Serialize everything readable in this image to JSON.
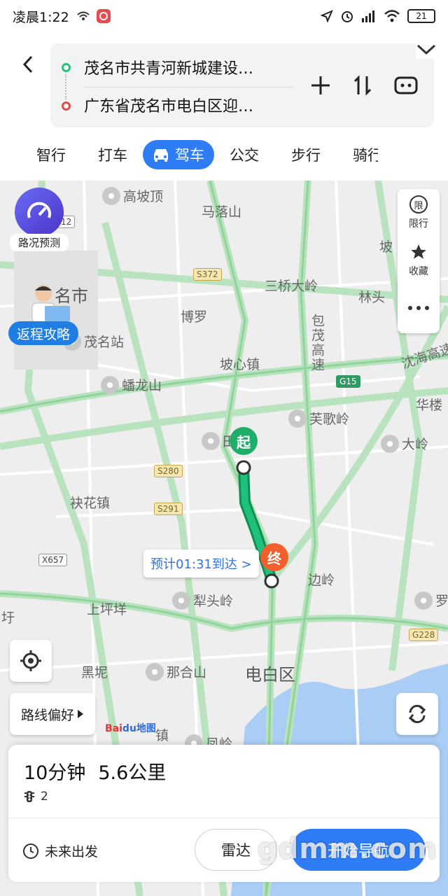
{
  "status_bar": {
    "time": "凌晨1:22",
    "battery": "21"
  },
  "route": {
    "origin": "茂名市共青河新城建设…",
    "destination": "广东省茂名市电白区迎…"
  },
  "modes": [
    {
      "label": "智行"
    },
    {
      "label": "打车"
    },
    {
      "label": "驾车",
      "active": true
    },
    {
      "label": "公交"
    },
    {
      "label": "步行"
    },
    {
      "label": "骑行"
    }
  ],
  "map": {
    "forecast_label": "路况预测",
    "return_guide_label": "返程攻略",
    "side_panel": {
      "restrict_label": "限行",
      "restrict_badge": "限",
      "favorite_label": "收藏"
    },
    "places": {
      "gaopoding": "高坡顶",
      "maluoshan": "马落山",
      "maoming_city": "名市",
      "boluo": "博罗",
      "sanqiao": "三桥大岭",
      "pocheng": "坡",
      "lintou": "林头",
      "maoming_station": "茂名站",
      "poxin": "坡心镇",
      "shanlongshan": "蟠龙山",
      "yinggeling": "芙歌岭",
      "tianshan": "田山",
      "daling": "大岭",
      "hualou": "华楼",
      "fuhua": "袂花镇",
      "bianling": "边岭",
      "litouling": "犁头岭",
      "shangpingyang": "上坪垟",
      "heini": "黑坭",
      "nahe": "那合山",
      "dianbai": "电白区",
      "fengling": "凤岭",
      "zhen": "镇",
      "luo": "罗",
      "left_edge": "圩",
      "baomao": "包茂高速",
      "shenhai": "沈海高速"
    },
    "shields": {
      "s372": "S372",
      "g15": "G15",
      "s280": "S280",
      "s291": "S291",
      "x657": "X657",
      "g228": "G228",
      "x612": "12"
    },
    "start_marker": "起",
    "end_marker": "终",
    "eta": "预计01:31到达 >",
    "route_pref_label": "路线偏好",
    "logo_text": "Bai",
    "logo_accent": "du地图"
  },
  "card": {
    "duration": "10分钟",
    "distance": "5.6公里",
    "traffic_lights": "2",
    "future_label": "未来出发",
    "radar_label": "雷达",
    "go_label": "开始导航",
    "watermark": "gdmm.com"
  },
  "colors": {
    "accent": "#2e7cf6",
    "route_green": "#1fae6a",
    "end_orange": "#f1602c"
  }
}
